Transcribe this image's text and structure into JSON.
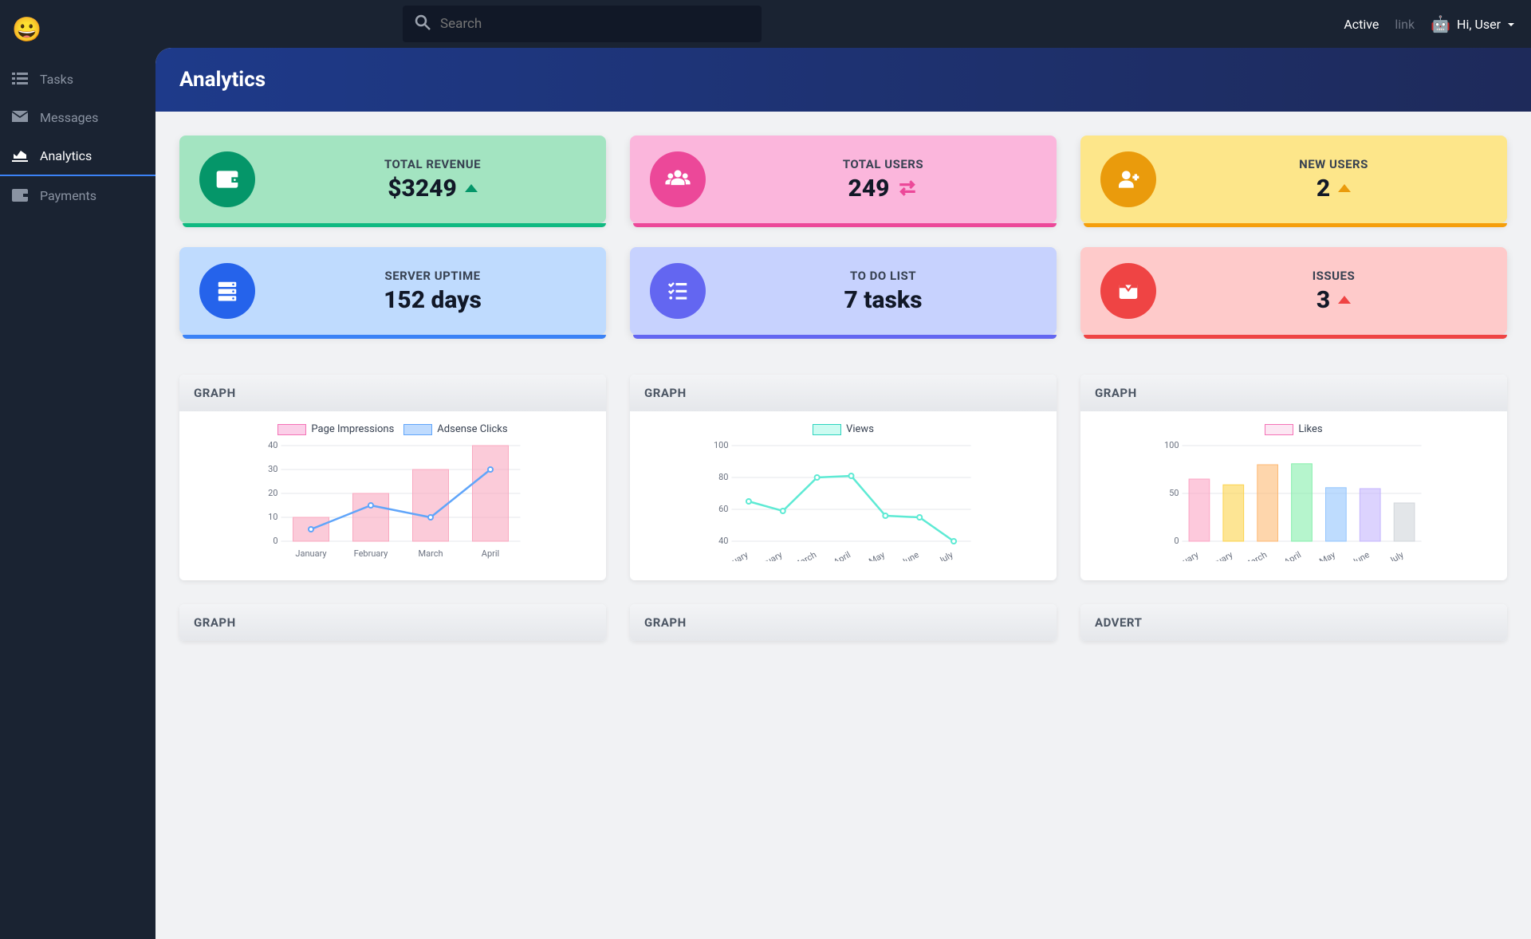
{
  "search": {
    "placeholder": "Search"
  },
  "topnav": {
    "active": "Active",
    "link": "link",
    "greeting": "Hi, User"
  },
  "sidebar": {
    "items": [
      {
        "label": "Tasks"
      },
      {
        "label": "Messages"
      },
      {
        "label": "Analytics"
      },
      {
        "label": "Payments"
      }
    ]
  },
  "page": {
    "title": "Analytics"
  },
  "stats": [
    {
      "label": "TOTAL REVENUE",
      "value": "$3249",
      "indicator": "up"
    },
    {
      "label": "TOTAL USERS",
      "value": "249",
      "indicator": "exchange"
    },
    {
      "label": "NEW USERS",
      "value": "2",
      "indicator": "up"
    },
    {
      "label": "SERVER UPTIME",
      "value": "152 days"
    },
    {
      "label": "TO DO LIST",
      "value": "7 tasks"
    },
    {
      "label": "ISSUES",
      "value": "3",
      "indicator": "up"
    }
  ],
  "graphs": [
    {
      "title": "GRAPH"
    },
    {
      "title": "GRAPH"
    },
    {
      "title": "GRAPH"
    },
    {
      "title": "GRAPH"
    },
    {
      "title": "GRAPH"
    },
    {
      "title": "ADVERT"
    }
  ],
  "chart_legends": {
    "chart1": {
      "s1": "Page Impressions",
      "s2": "Adsense Clicks"
    },
    "chart2": {
      "s1": "Views"
    },
    "chart3": {
      "s1": "Likes"
    }
  },
  "chart_data": [
    {
      "type": "bar+line",
      "categories": [
        "January",
        "February",
        "March",
        "April"
      ],
      "series": [
        {
          "name": "Page Impressions",
          "type": "bar",
          "values": [
            10,
            20,
            30,
            40
          ],
          "color": "#f9a8c0"
        },
        {
          "name": "Adsense Clicks",
          "type": "line",
          "values": [
            5,
            15,
            10,
            30
          ],
          "color": "#60a5fa"
        }
      ],
      "ylim": [
        0,
        40
      ],
      "yticks": [
        0,
        10,
        20,
        30,
        40
      ]
    },
    {
      "type": "line",
      "categories": [
        "January",
        "February",
        "March",
        "April",
        "May",
        "June",
        "July"
      ],
      "series": [
        {
          "name": "Views",
          "values": [
            65,
            59,
            80,
            81,
            56,
            55,
            40
          ],
          "color": "#5eead4"
        }
      ],
      "ylim": [
        40,
        100
      ],
      "yticks": [
        40,
        60,
        80,
        100
      ]
    },
    {
      "type": "bar",
      "categories": [
        "January",
        "February",
        "March",
        "April",
        "May",
        "June",
        "July"
      ],
      "series": [
        {
          "name": "Likes",
          "values": [
            65,
            59,
            80,
            81,
            56,
            55,
            40
          ]
        }
      ],
      "bar_colors": [
        "#fca5c4",
        "#fcd34d",
        "#fdba74",
        "#86efac",
        "#93c5fd",
        "#c4b5fd",
        "#d1d5db"
      ],
      "ylim": [
        0,
        100
      ],
      "yticks": [
        0,
        50,
        100
      ]
    }
  ]
}
